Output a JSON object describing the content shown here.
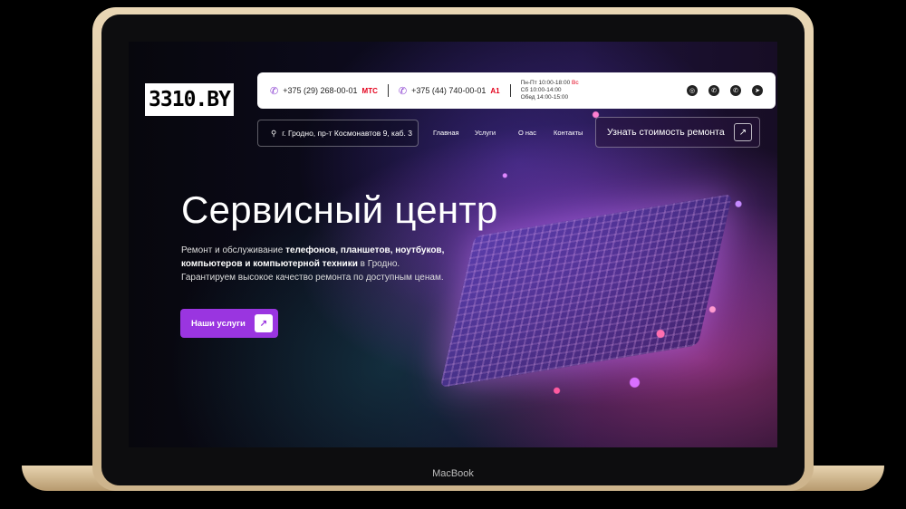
{
  "logo": {
    "text": "3310.BY"
  },
  "topbar": {
    "phone1": "+375 (29) 268-00-01",
    "op1": "МТС",
    "phone2": "+375 (44) 740-00-01",
    "op2": "A1",
    "hours_l1": "Пн-Пт 10:00-18:00",
    "hours_l1_off": "Вс",
    "hours_l2": "Сб 10:00-14:00",
    "hours_l3": "Обед 14:00-15:00"
  },
  "address": "г. Гродно, пр-т Космонавтов 9, каб. 3",
  "nav": {
    "home": "Главная",
    "services": "Услуги",
    "about": "О нас",
    "contacts": "Контакты"
  },
  "cta": {
    "label": "Узнать стоимость ремонта"
  },
  "hero": {
    "title": "Сервисный центр",
    "desc_a": "Ремонт и обслуживание ",
    "desc_b": "телефонов, планшетов, ноутбуков, компьютеров и компьютерной техники",
    "desc_c": " в Гродно.",
    "desc_d": "Гарантируем высокое качество ремонта по доступным ценам."
  },
  "button": {
    "label": "Наши услуги"
  },
  "device": {
    "label": "MacBook"
  },
  "colors": {
    "accent": "#9a35e0",
    "mts": "#e3001b"
  }
}
